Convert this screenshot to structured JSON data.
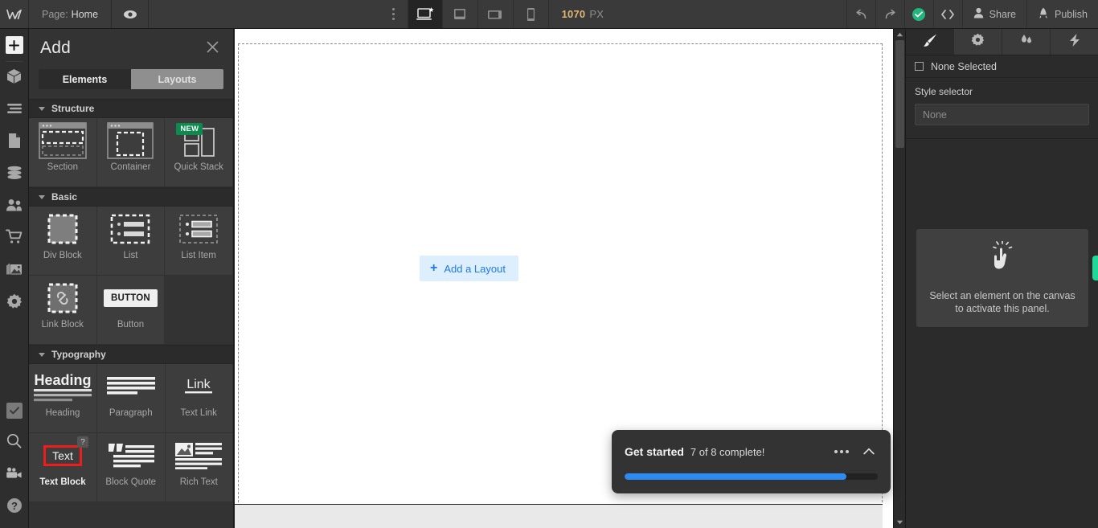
{
  "topbar": {
    "logo_icon": "webflow-logo-icon",
    "page_prefix": "Page:",
    "page_name": "Home",
    "eye_icon": "preview-eye-icon",
    "kebab_icon": "more-options-icon",
    "devices": [
      {
        "name": "desktop",
        "icon": "desktop-star-icon",
        "active": true
      },
      {
        "name": "tablet",
        "icon": "tablet-icon",
        "active": false
      },
      {
        "name": "tablet-landscape",
        "icon": "tablet-landscape-icon",
        "active": false
      },
      {
        "name": "mobile",
        "icon": "mobile-icon",
        "active": false
      }
    ],
    "viewport_value": "1070",
    "viewport_unit": "PX",
    "undo_icon": "undo-icon",
    "redo_icon": "redo-icon",
    "saved_icon": "saved-check-icon",
    "code_label": "< >",
    "share_label": "Share",
    "share_icon": "person-icon",
    "publish_label": "Publish",
    "publish_icon": "rocket-icon"
  },
  "rail": {
    "items": [
      {
        "name": "add",
        "icon": "plus-icon",
        "active": true
      },
      {
        "name": "components",
        "icon": "cube-icon",
        "active": false
      },
      {
        "name": "navigator",
        "icon": "navigator-icon",
        "active": false
      },
      {
        "name": "pages",
        "icon": "page-icon",
        "active": false
      },
      {
        "name": "cms",
        "icon": "database-icon",
        "active": false
      },
      {
        "name": "users",
        "icon": "people-icon",
        "active": false
      },
      {
        "name": "ecommerce",
        "icon": "cart-icon",
        "active": false
      },
      {
        "name": "assets",
        "icon": "images-icon",
        "active": false
      },
      {
        "name": "settings",
        "icon": "gear-icon",
        "active": false
      }
    ],
    "bottom_items": [
      {
        "name": "audit",
        "icon": "checkbox-icon"
      },
      {
        "name": "search",
        "icon": "search-icon"
      },
      {
        "name": "video",
        "icon": "video-camera-icon"
      },
      {
        "name": "help",
        "icon": "help-question-icon"
      }
    ]
  },
  "add_panel": {
    "title": "Add",
    "close_icon": "close-icon",
    "tabs": [
      {
        "label": "Elements",
        "active": true
      },
      {
        "label": "Layouts",
        "active": false
      }
    ],
    "sections": [
      {
        "title": "Structure",
        "items": [
          {
            "label": "Section",
            "icon": "section-icon",
            "badge": null,
            "highlight": false
          },
          {
            "label": "Container",
            "icon": "container-icon",
            "badge": null,
            "highlight": false
          },
          {
            "label": "Quick Stack",
            "icon": "quick-stack-icon",
            "badge": "NEW",
            "highlight": false
          }
        ]
      },
      {
        "title": "Basic",
        "items": [
          {
            "label": "Div Block",
            "icon": "div-block-icon",
            "badge": null,
            "highlight": false
          },
          {
            "label": "List",
            "icon": "list-icon",
            "badge": null,
            "highlight": false
          },
          {
            "label": "List Item",
            "icon": "list-item-icon",
            "badge": null,
            "highlight": false
          },
          {
            "label": "Link Block",
            "icon": "link-block-icon",
            "badge": null,
            "highlight": false
          },
          {
            "label": "Button",
            "icon": "button-icon",
            "badge": null,
            "highlight": false
          },
          {
            "label": "",
            "icon": null,
            "badge": null,
            "highlight": false
          }
        ]
      },
      {
        "title": "Typography",
        "items": [
          {
            "label": "Heading",
            "icon": "heading-icon",
            "badge": null,
            "highlight": false
          },
          {
            "label": "Paragraph",
            "icon": "paragraph-icon",
            "badge": null,
            "highlight": false
          },
          {
            "label": "Text Link",
            "icon": "text-link-icon",
            "badge": null,
            "highlight": false
          },
          {
            "label": "Text Block",
            "icon": "text-block-icon",
            "badge": "?",
            "highlight": true
          },
          {
            "label": "Block Quote",
            "icon": "block-quote-icon",
            "badge": null,
            "highlight": false
          },
          {
            "label": "Rich Text",
            "icon": "rich-text-icon",
            "badge": null,
            "highlight": false
          }
        ]
      }
    ],
    "tile_icon_text": {
      "heading": "Heading",
      "link": "Link",
      "button": "BUTTON",
      "text": "Text"
    }
  },
  "canvas": {
    "add_layout_label": "Add a Layout",
    "add_layout_plus": "+",
    "scrollbar_up_icon": "scroll-up-arrow-icon",
    "scrollbar_down_icon": "scroll-down-arrow-icon"
  },
  "get_started": {
    "title": "Get started",
    "progress_label": "7 of 8 complete!",
    "progress_percent": 87.5,
    "menu_icon": "ellipsis-icon",
    "collapse_icon": "chevron-up-icon",
    "bar_color": "#2b8bf2"
  },
  "right_panel": {
    "tabs": [
      {
        "name": "style",
        "icon": "paintbrush-icon",
        "active": true
      },
      {
        "name": "settings",
        "icon": "gear-icon",
        "active": false
      },
      {
        "name": "interactions",
        "icon": "droplets-icon",
        "active": false
      },
      {
        "name": "effects",
        "icon": "lightning-icon",
        "active": false
      }
    ],
    "selection_label": "None Selected",
    "selection_icon": "selection-square-icon",
    "style_selector_label": "Style selector",
    "style_selector_value": "None",
    "empty_state_icon": "click-hand-icon",
    "empty_state_text": "Select an element on the canvas to activate this panel.",
    "accent_tab_color": "#1fd99b"
  }
}
